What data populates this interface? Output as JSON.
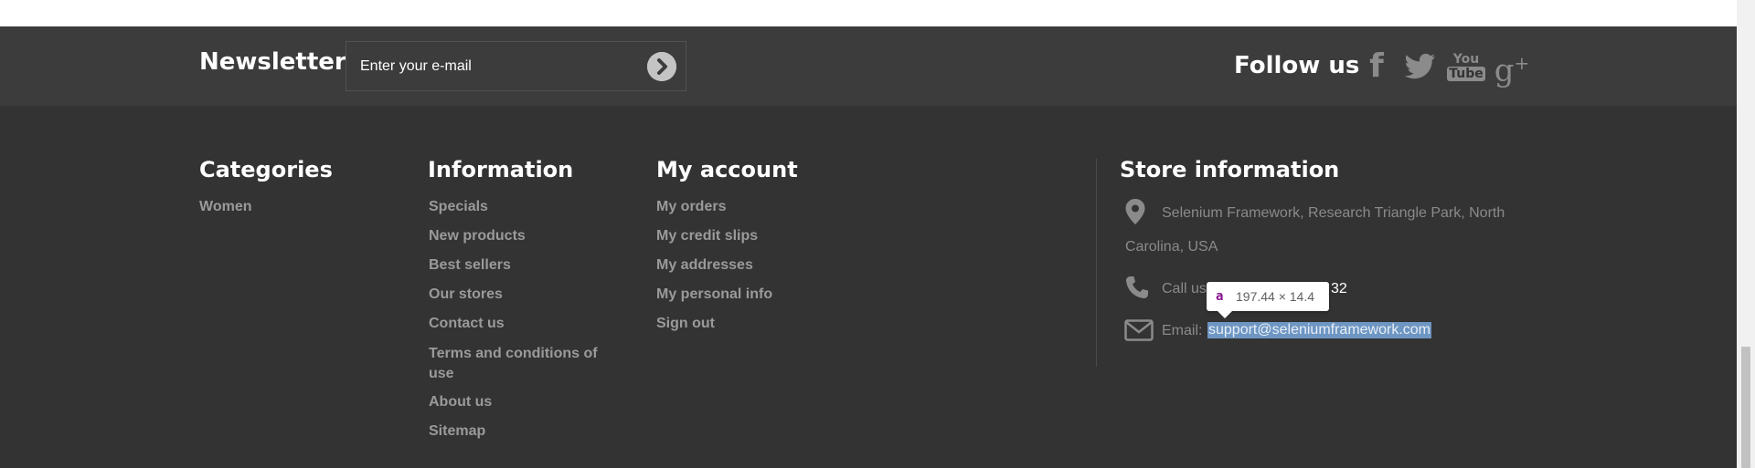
{
  "newsletter": {
    "title": "Newsletter",
    "email_placeholder": "Enter your e-mail",
    "submit_icon": "chevron-right-circle-icon"
  },
  "follow": {
    "title": "Follow us",
    "networks": [
      {
        "name": "facebook-icon",
        "glyph": "f"
      },
      {
        "name": "twitter-icon",
        "glyph": "bird"
      },
      {
        "name": "youtube-icon",
        "glyph": "You Tube"
      },
      {
        "name": "google-plus-icon",
        "glyph": "g+"
      }
    ]
  },
  "categories": {
    "title": "Categories",
    "items": [
      "Women"
    ]
  },
  "information": {
    "title": "Information",
    "items": [
      "Specials",
      "New products",
      "Best sellers",
      "Our stores",
      "Contact us",
      "Terms and conditions of use",
      "About us",
      "Sitemap"
    ]
  },
  "account": {
    "title": "My account",
    "items": [
      "My orders",
      "My credit slips",
      "My addresses",
      "My personal info",
      "Sign out"
    ]
  },
  "store": {
    "title": "Store information",
    "address_line1": "Selenium Framework, Research Triangle Park, North",
    "address_line2": "Carolina, USA",
    "call_prefix": "Call us",
    "call_tail": "32",
    "email_label": "Email:",
    "email": "support@seleniumframework.com"
  },
  "tooltip": {
    "tag": "a",
    "dimensions": "197.44 × 14.4"
  },
  "colors": {
    "footer_bg": "#333333",
    "newsletter_bg": "#3c3c3c",
    "link": "#9a9a9a",
    "icon": "#8b8b8b",
    "selection": "#6e96c3"
  }
}
